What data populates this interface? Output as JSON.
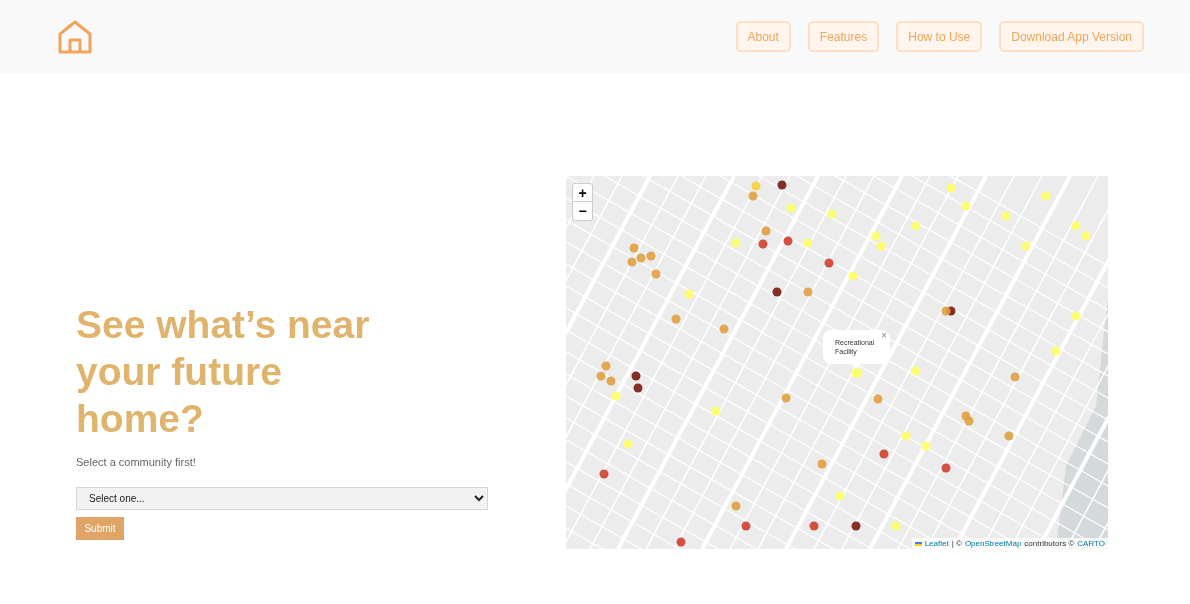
{
  "header": {
    "nav": [
      {
        "label": "About"
      },
      {
        "label": "Features"
      },
      {
        "label": "How to Use"
      },
      {
        "label": "Download App Version"
      }
    ]
  },
  "hero": {
    "heading": "See what’s near your future home?",
    "prompt": "Select a community first!",
    "select": {
      "value": "Select one..."
    },
    "submit": "Submit"
  },
  "map": {
    "zoom_in": "+",
    "zoom_out": "−",
    "popup": {
      "text": "Recreational Facility",
      "close": "×"
    },
    "attribution": {
      "leaflet": "Leaflet",
      "separator": "| ©",
      "osm": "OpenStreetMap",
      "contributors": "contributors ©",
      "carto": "CARTO"
    }
  }
}
